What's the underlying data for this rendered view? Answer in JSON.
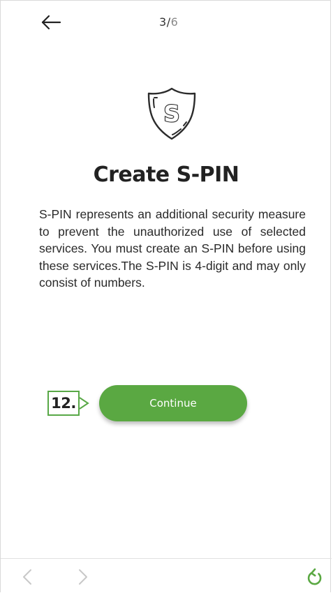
{
  "header": {
    "step_current": "3",
    "step_separator": "/",
    "step_total": "6"
  },
  "content": {
    "title": "Create S-PIN",
    "description": "S-PIN represents an additional security measure to prevent the unauthorized use of selected services. You must create an S-PIN before using these services.The S-PIN is 4-digit and may only consist of numbers.",
    "shield_letter": "S"
  },
  "actions": {
    "continue_label": "Continue"
  },
  "annotation": {
    "step_marker": "12."
  },
  "icons": {
    "back": "arrow-left-icon",
    "shield": "shield-s-icon",
    "nav_back": "chevron-left-icon",
    "nav_forward": "chevron-right-icon",
    "reload": "reload-icon"
  },
  "colors": {
    "accent_green": "#5aa842",
    "callout_border": "#58a846",
    "text_dark": "#222222",
    "text_muted": "#8a8a8a",
    "disabled_nav": "#c8c8c8"
  }
}
